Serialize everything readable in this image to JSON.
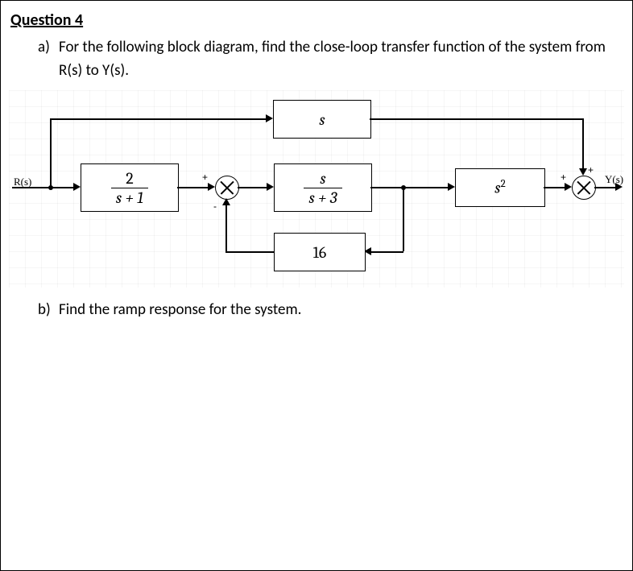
{
  "question": {
    "number_label": "Question 4",
    "part_a_letter": "a)",
    "part_a_text": "For the following block diagram, find the close-loop transfer function of the system from R(s) to Y(s).",
    "part_b_letter": "b)",
    "part_b_text": "Find the ramp response for the system."
  },
  "diagram": {
    "input_label": "R(s)",
    "output_label": "Y(s)",
    "blocks": {
      "g1_num": "2",
      "g1_den": "s + 1",
      "h_top": "s",
      "g2_num": "s",
      "g2_den": "s + 3",
      "h_fb": "16",
      "g3": "s",
      "g3_exp": "2"
    },
    "signs": {
      "sum1_left": "+",
      "sum1_bottom": "-",
      "sum2_left": "+",
      "sum2_top": "+"
    }
  }
}
